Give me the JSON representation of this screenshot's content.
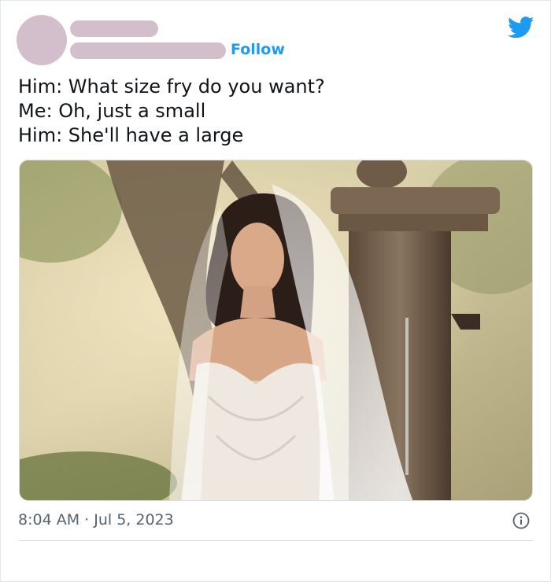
{
  "tweet": {
    "follow_label": "Follow",
    "lines": [
      "Him: What size fry do you want?",
      "Me: Oh, just a small",
      "Him: She'll have a large"
    ],
    "time": "8:04 AM",
    "separator": "·",
    "date": "Jul 5, 2023"
  },
  "icons": {
    "brand": "twitter-bird-icon",
    "info": "info-icon"
  },
  "colors": {
    "accent": "#1d9bf0",
    "placeholder": "#d3bfcc",
    "text": "#0f1419",
    "muted": "#536471"
  }
}
